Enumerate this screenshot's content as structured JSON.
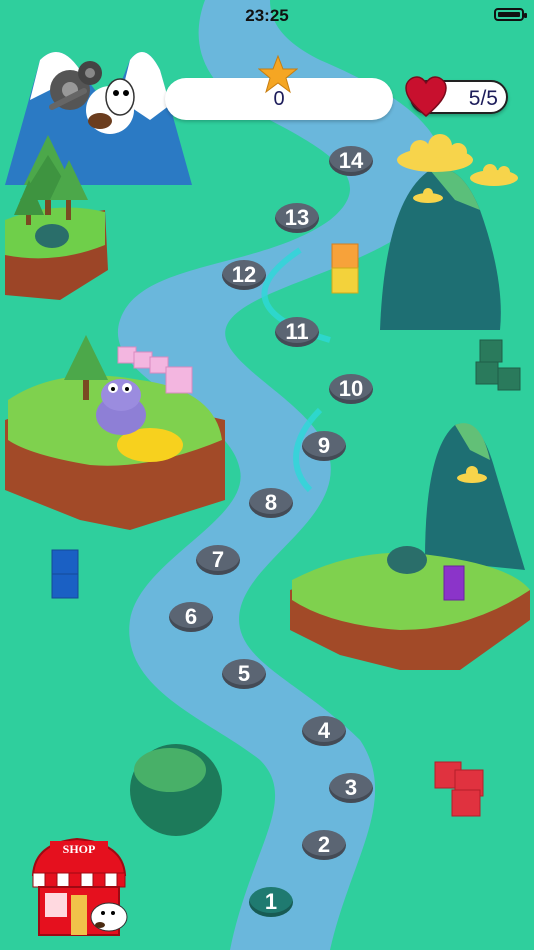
{
  "status_bar": {
    "time": "23:25"
  },
  "hud": {
    "score": "0",
    "lives": "5/5"
  },
  "shop": {
    "label": "SHOP"
  },
  "levels": [
    "1",
    "2",
    "3",
    "4",
    "5",
    "6",
    "7",
    "8",
    "9",
    "10",
    "11",
    "12",
    "13",
    "14"
  ],
  "current_level": "1",
  "colors": {
    "background": "#2fcf9d",
    "river": "#6ab7dc",
    "node": "#5b6573",
    "node_current": "#1f7a70",
    "star": "#f5a623",
    "heart": "#c8102e"
  }
}
